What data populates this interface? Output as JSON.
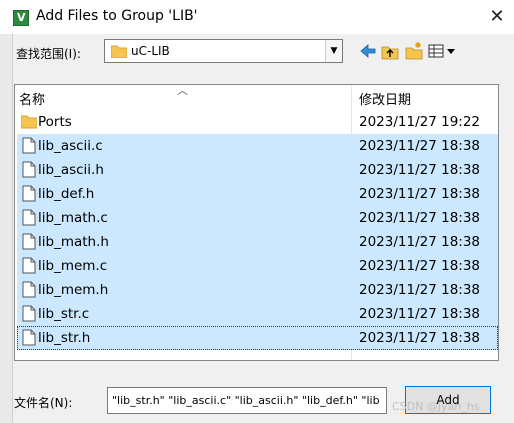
{
  "window": {
    "title": "Add Files to Group 'LIB'",
    "close_glyph": "✕"
  },
  "lookin": {
    "label": "查找范围(I):",
    "value": "uC-LIB"
  },
  "toolbar": {
    "view_glyph": "▦▾"
  },
  "list": {
    "col_name": "名称",
    "col_date": "修改日期",
    "rows": [
      {
        "name": "Ports",
        "date": "2023/11/27 19:22",
        "type": "folder",
        "state": ""
      },
      {
        "name": "lib_ascii.c",
        "date": "2023/11/27 18:38",
        "type": "file",
        "state": "selected"
      },
      {
        "name": "lib_ascii.h",
        "date": "2023/11/27 18:38",
        "type": "file",
        "state": "selected"
      },
      {
        "name": "lib_def.h",
        "date": "2023/11/27 18:38",
        "type": "file",
        "state": "selected"
      },
      {
        "name": "lib_math.c",
        "date": "2023/11/27 18:38",
        "type": "file",
        "state": "selected"
      },
      {
        "name": "lib_math.h",
        "date": "2023/11/27 18:38",
        "type": "file",
        "state": "selected"
      },
      {
        "name": "lib_mem.c",
        "date": "2023/11/27 18:38",
        "type": "file",
        "state": "selected"
      },
      {
        "name": "lib_mem.h",
        "date": "2023/11/27 18:38",
        "type": "file",
        "state": "selected"
      },
      {
        "name": "lib_str.c",
        "date": "2023/11/27 18:38",
        "type": "file",
        "state": "selected"
      },
      {
        "name": "lib_str.h",
        "date": "2023/11/27 18:38",
        "type": "file",
        "state": "focused"
      }
    ]
  },
  "filename": {
    "label": "文件名(N):",
    "value": "\"lib_str.h\" \"lib_ascii.c\" \"lib_ascii.h\" \"lib_def.h\" \"lib"
  },
  "add_button": {
    "label": "Add"
  },
  "watermark": "CSDN @Jyan_hs"
}
